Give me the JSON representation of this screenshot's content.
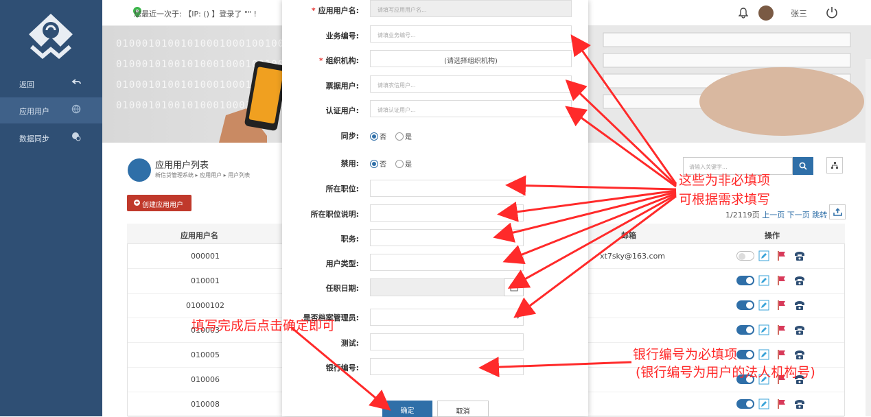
{
  "header": {
    "last_login_note": "您最近一次于: 【IP: () 】登录了 \"\" !",
    "user_name": "张三"
  },
  "sidebar": {
    "items": [
      {
        "label": "返回"
      },
      {
        "label": "应用用户"
      },
      {
        "label": "数据同步"
      }
    ]
  },
  "banner": {
    "binary_rows": [
      "0100010100101000100010010010001010010001001000100101000101001010001000",
      "0100010100101000100010010010001010010001001000100101000101001010001000",
      "0100010100101000100010010010001010010001001000100101000101001010001000",
      "0100010100101000100010010010001010010001001000100101000101001010001000"
    ]
  },
  "list": {
    "title": "应用用户列表",
    "breadcrumb": "新信贷管理系统 ▸ 应用用户 ▸ 用户列表",
    "create_label": "创建应用用户",
    "search_placeholder": "请输入关键字...",
    "pager": {
      "count": "1/2119页",
      "prev": "上一页",
      "next": "下一页",
      "jump": "跳转"
    },
    "columns": {
      "name": "应用用户名",
      "email": "邮箱",
      "ops": "操作"
    },
    "rows": [
      {
        "name": "000001",
        "email": "xt7sky@163.com",
        "enabled": false
      },
      {
        "name": "010001",
        "email": "",
        "enabled": true
      },
      {
        "name": "01000102",
        "email": "",
        "enabled": true
      },
      {
        "name": "010003",
        "email": "",
        "enabled": true
      },
      {
        "name": "010005",
        "email": "",
        "enabled": true
      },
      {
        "name": "010006",
        "email": "",
        "enabled": true
      },
      {
        "name": "010008",
        "email": "",
        "enabled": true
      }
    ]
  },
  "form": {
    "app_user_name": {
      "label": "应用用户名:",
      "placeholder": "请填写应用用户名..."
    },
    "business_no": {
      "label": "业务编号:",
      "placeholder": "请填业务编号..."
    },
    "org": {
      "label": "组织机构:",
      "value": "(请选择组织机构)"
    },
    "bill_user": {
      "label": "票据用户:",
      "placeholder": "请填农信用户..."
    },
    "auth_user": {
      "label": "认证用户:",
      "placeholder": "请填认证用户..."
    },
    "sync": {
      "label": "同步:",
      "no": "否",
      "yes": "是"
    },
    "disabled": {
      "label": "禁用:",
      "no": "否",
      "yes": "是"
    },
    "position": {
      "label": "所在职位:"
    },
    "position_desc": {
      "label": "所在职位说明:"
    },
    "duty": {
      "label": "职务:"
    },
    "user_type": {
      "label": "用户类型:"
    },
    "hire_date": {
      "label": "任职日期:"
    },
    "archive_admin": {
      "label": "是否档案管理员:"
    },
    "test": {
      "label": "测试:"
    },
    "bank_no": {
      "label": "银行编号:"
    },
    "ok": "确定",
    "cancel": "取消"
  },
  "annotations": {
    "optional_line1": "这些为非必填项",
    "optional_line2": "可根据需求填写",
    "confirm_hint": "填写完成后点击确定即可",
    "bank_line1": "银行编号为必填项",
    "bank_line2": "(银行编号为用户的法人机构号)"
  },
  "colors": {
    "sidebar": "#2f4f74",
    "primary": "#2f6fa8",
    "danger": "#c0392b",
    "annotation": "#ff2a2a"
  }
}
